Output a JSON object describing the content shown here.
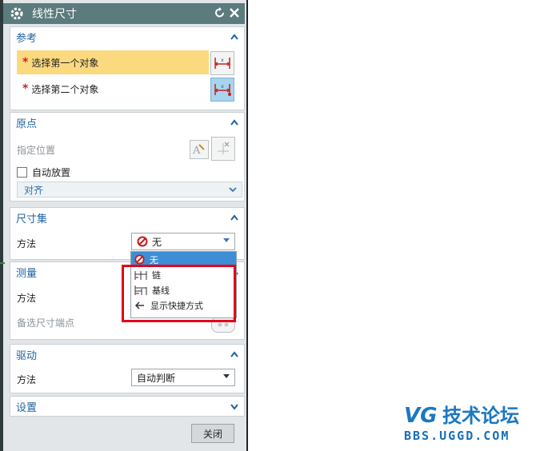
{
  "dialog": {
    "title": "线性尺寸",
    "close_label": "关闭"
  },
  "reference": {
    "header": "参考",
    "first_object": "选择第一个对象",
    "second_object": "选择第二个对象",
    "required_mark": "*"
  },
  "origin": {
    "header": "原点",
    "specify_location": "指定位置",
    "auto_place": "自动放置",
    "alignment": "对齐"
  },
  "dimension_set": {
    "header": "尺寸集",
    "method_label": "方法",
    "method_value": "无",
    "options": [
      "无",
      "链",
      "基线",
      "显示快捷方式"
    ]
  },
  "measure": {
    "header": "测量",
    "method_label": "方法",
    "alt_endpoint": "备选尺寸端点"
  },
  "drive": {
    "header": "驱动",
    "method_label": "方法",
    "method_value": "自动判断"
  },
  "settings": {
    "header": "设置"
  },
  "watermark": {
    "logo": "UG技术论坛",
    "url": "BBS.UGGD.COM"
  },
  "colors": {
    "title_bar": "#5b7b7d",
    "section_header": "#1f62a0",
    "active_row": "#fbd97f",
    "highlight": "#3d8ed4",
    "annotation_box": "#e3001b"
  }
}
